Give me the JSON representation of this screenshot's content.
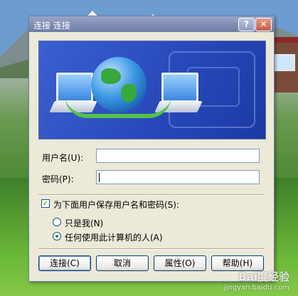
{
  "window": {
    "title": "连接 连接"
  },
  "titlebar": {
    "help_glyph": "?",
    "close_glyph": "✕"
  },
  "form": {
    "username_label": "用户名(U):",
    "username_value": "",
    "password_label": "密码(P):",
    "password_value": ""
  },
  "options": {
    "save_checkbox_label": "为下面用户保存用户名和密码(S):",
    "save_checked": true,
    "radio_only_me_label": "只是我(N)",
    "radio_anyone_label": "任何使用此计算机的人(A)",
    "selected": "anyone"
  },
  "buttons": {
    "connect": "连接(C)",
    "cancel": "取消",
    "properties": "属性(O)",
    "help": "帮助(H)"
  },
  "watermark": {
    "brand": "Bai度经验",
    "url": "jingyan.baidu.com"
  },
  "colors": {
    "titlebar": "#7f8cb3",
    "dialog_bg": "#ece9d8",
    "banner": "#2747b8"
  }
}
